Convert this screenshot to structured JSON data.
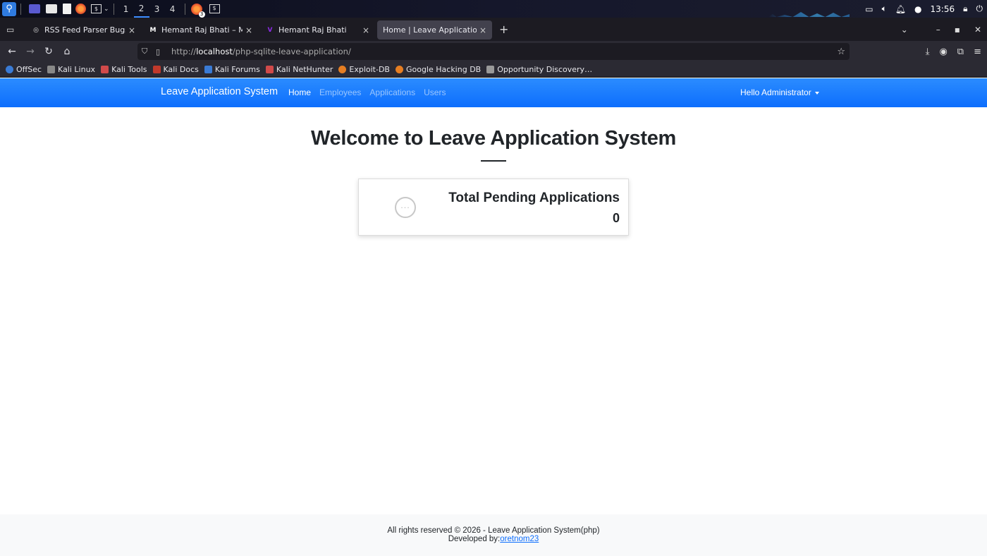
{
  "taskbar": {
    "workspaces": [
      "1",
      "2",
      "3",
      "4"
    ],
    "active_workspace": "2",
    "time": "13:56",
    "firefox_badge": "3",
    "icons": [
      "kali-menu-icon",
      "desktop-icon",
      "file-manager-icon",
      "text-editor-icon",
      "firefox-icon",
      "terminal-icon"
    ]
  },
  "tabs": [
    {
      "title": "RSS Feed Parser Bugs",
      "icon": "globe-icon"
    },
    {
      "title": "Hemant Raj Bhati – Mediu",
      "icon": "medium-icon"
    },
    {
      "title": "Hemant Raj Bhati",
      "icon": "v-icon"
    },
    {
      "title": "Home | Leave Application Sys",
      "icon": "",
      "active": true
    }
  ],
  "url": {
    "prefix": "http://",
    "host": "localhost",
    "path": "/php-sqlite-leave-application/"
  },
  "bookmarks": [
    {
      "label": "OffSec",
      "color": "#3a7bd5"
    },
    {
      "label": "Kali Linux",
      "color": "#888"
    },
    {
      "label": "Kali Tools",
      "color": "#d04a4a"
    },
    {
      "label": "Kali Docs",
      "color": "#c0392b"
    },
    {
      "label": "Kali Forums",
      "color": "#3a7bd5"
    },
    {
      "label": "Kali NetHunter",
      "color": "#d04a4a"
    },
    {
      "label": "Exploit-DB",
      "color": "#e67e22"
    },
    {
      "label": "Google Hacking DB",
      "color": "#e67e22"
    },
    {
      "label": "Opportunity Discovery…",
      "color": "#999"
    }
  ],
  "app": {
    "brand": "Leave Application System",
    "nav": [
      {
        "label": "Home",
        "active": true
      },
      {
        "label": "Employees"
      },
      {
        "label": "Applications"
      },
      {
        "label": "Users"
      }
    ],
    "user_menu": "Hello Administrator",
    "headline": "Welcome to Leave Application System",
    "card": {
      "title": "Total Pending Applications",
      "value": "0"
    },
    "footer": {
      "line1": "All rights reserved © 2026 - Leave Application System(php)",
      "dev_prefix": "Developed by:",
      "dev_link": "oretnom23"
    }
  },
  "colors": {
    "accent": "#0d6efd",
    "footer_bg": "#f8f9fa"
  }
}
